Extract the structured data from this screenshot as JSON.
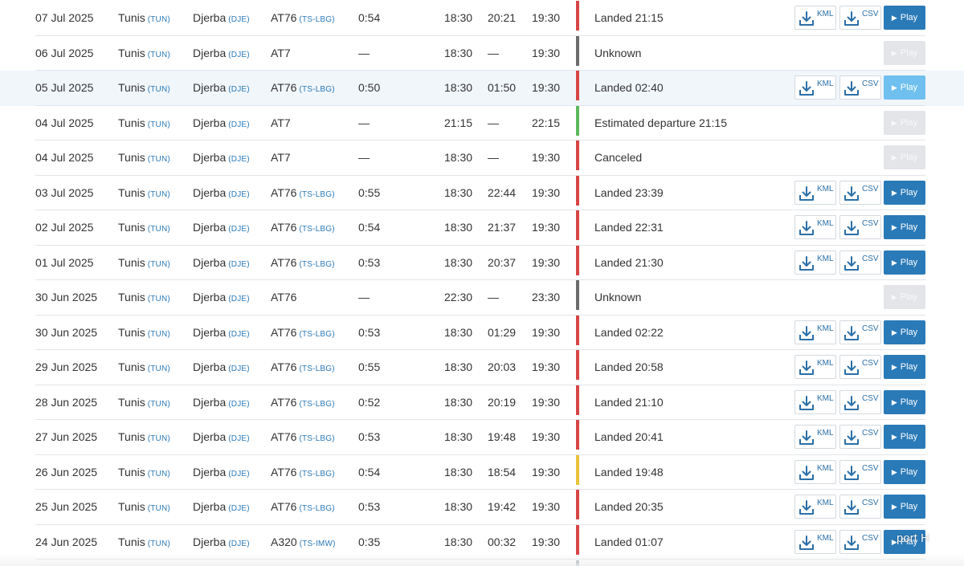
{
  "colors": {
    "red": "#d64545",
    "gray": "#6b6b6b",
    "green": "#5cb85c",
    "yellow": "#e8c33a",
    "play": "#2a7ab8",
    "play_light": "#6fc0ee",
    "play_disabled": "#e3e5e8"
  },
  "labels": {
    "kml": "KML",
    "csv": "CSV",
    "play": "Play"
  },
  "icons": {
    "download": "download-icon",
    "play": "play-triangle-icon"
  },
  "overlay_text": "port   H",
  "flights": [
    {
      "date": "07 Jul 2025",
      "from": "Tunis",
      "from_code": "(TUN)",
      "to": "Djerba",
      "to_code": "(DJE)",
      "aircraft": "AT76",
      "reg": "(TS-LBG)",
      "duration": "0:54",
      "std": "18:30",
      "atd": "20:21",
      "sta": "19:30",
      "status": "Landed 21:15",
      "status_color": "red",
      "has_downloads": true,
      "play_state": "active",
      "highlight": false
    },
    {
      "date": "06 Jul 2025",
      "from": "Tunis",
      "from_code": "(TUN)",
      "to": "Djerba",
      "to_code": "(DJE)",
      "aircraft": "AT7",
      "reg": "",
      "duration": "—",
      "std": "18:30",
      "atd": "—",
      "sta": "19:30",
      "status": "Unknown",
      "status_color": "gray",
      "has_downloads": false,
      "play_state": "disabled",
      "highlight": false
    },
    {
      "date": "05 Jul 2025",
      "from": "Tunis",
      "from_code": "(TUN)",
      "to": "Djerba",
      "to_code": "(DJE)",
      "aircraft": "AT76",
      "reg": "(TS-LBG)",
      "duration": "0:50",
      "std": "18:30",
      "atd": "01:50",
      "sta": "19:30",
      "status": "Landed 02:40",
      "status_color": "red",
      "has_downloads": true,
      "play_state": "light",
      "highlight": true
    },
    {
      "date": "04 Jul 2025",
      "from": "Tunis",
      "from_code": "(TUN)",
      "to": "Djerba",
      "to_code": "(DJE)",
      "aircraft": "AT7",
      "reg": "",
      "duration": "—",
      "std": "21:15",
      "atd": "—",
      "sta": "22:15",
      "status": "Estimated departure 21:15",
      "status_color": "green",
      "has_downloads": false,
      "play_state": "disabled",
      "highlight": false
    },
    {
      "date": "04 Jul 2025",
      "from": "Tunis",
      "from_code": "(TUN)",
      "to": "Djerba",
      "to_code": "(DJE)",
      "aircraft": "AT7",
      "reg": "",
      "duration": "—",
      "std": "18:30",
      "atd": "—",
      "sta": "19:30",
      "status": "Canceled",
      "status_color": "red",
      "has_downloads": false,
      "play_state": "disabled",
      "highlight": false
    },
    {
      "date": "03 Jul 2025",
      "from": "Tunis",
      "from_code": "(TUN)",
      "to": "Djerba",
      "to_code": "(DJE)",
      "aircraft": "AT76",
      "reg": "(TS-LBG)",
      "duration": "0:55",
      "std": "18:30",
      "atd": "22:44",
      "sta": "19:30",
      "status": "Landed 23:39",
      "status_color": "red",
      "has_downloads": true,
      "play_state": "active",
      "highlight": false
    },
    {
      "date": "02 Jul 2025",
      "from": "Tunis",
      "from_code": "(TUN)",
      "to": "Djerba",
      "to_code": "(DJE)",
      "aircraft": "AT76",
      "reg": "(TS-LBG)",
      "duration": "0:54",
      "std": "18:30",
      "atd": "21:37",
      "sta": "19:30",
      "status": "Landed 22:31",
      "status_color": "red",
      "has_downloads": true,
      "play_state": "active",
      "highlight": false
    },
    {
      "date": "01 Jul 2025",
      "from": "Tunis",
      "from_code": "(TUN)",
      "to": "Djerba",
      "to_code": "(DJE)",
      "aircraft": "AT76",
      "reg": "(TS-LBG)",
      "duration": "0:53",
      "std": "18:30",
      "atd": "20:37",
      "sta": "19:30",
      "status": "Landed 21:30",
      "status_color": "red",
      "has_downloads": true,
      "play_state": "active",
      "highlight": false
    },
    {
      "date": "30 Jun 2025",
      "from": "Tunis",
      "from_code": "(TUN)",
      "to": "Djerba",
      "to_code": "(DJE)",
      "aircraft": "AT76",
      "reg": "",
      "duration": "—",
      "std": "22:30",
      "atd": "—",
      "sta": "23:30",
      "status": "Unknown",
      "status_color": "gray",
      "has_downloads": false,
      "play_state": "disabled",
      "highlight": false
    },
    {
      "date": "30 Jun 2025",
      "from": "Tunis",
      "from_code": "(TUN)",
      "to": "Djerba",
      "to_code": "(DJE)",
      "aircraft": "AT76",
      "reg": "(TS-LBG)",
      "duration": "0:53",
      "std": "18:30",
      "atd": "01:29",
      "sta": "19:30",
      "status": "Landed 02:22",
      "status_color": "red",
      "has_downloads": true,
      "play_state": "active",
      "highlight": false
    },
    {
      "date": "29 Jun 2025",
      "from": "Tunis",
      "from_code": "(TUN)",
      "to": "Djerba",
      "to_code": "(DJE)",
      "aircraft": "AT76",
      "reg": "(TS-LBG)",
      "duration": "0:55",
      "std": "18:30",
      "atd": "20:03",
      "sta": "19:30",
      "status": "Landed 20:58",
      "status_color": "red",
      "has_downloads": true,
      "play_state": "active",
      "highlight": false
    },
    {
      "date": "28 Jun 2025",
      "from": "Tunis",
      "from_code": "(TUN)",
      "to": "Djerba",
      "to_code": "(DJE)",
      "aircraft": "AT76",
      "reg": "(TS-LBG)",
      "duration": "0:52",
      "std": "18:30",
      "atd": "20:19",
      "sta": "19:30",
      "status": "Landed 21:10",
      "status_color": "red",
      "has_downloads": true,
      "play_state": "active",
      "highlight": false
    },
    {
      "date": "27 Jun 2025",
      "from": "Tunis",
      "from_code": "(TUN)",
      "to": "Djerba",
      "to_code": "(DJE)",
      "aircraft": "AT76",
      "reg": "(TS-LBG)",
      "duration": "0:53",
      "std": "18:30",
      "atd": "19:48",
      "sta": "19:30",
      "status": "Landed 20:41",
      "status_color": "red",
      "has_downloads": true,
      "play_state": "active",
      "highlight": false
    },
    {
      "date": "26 Jun 2025",
      "from": "Tunis",
      "from_code": "(TUN)",
      "to": "Djerba",
      "to_code": "(DJE)",
      "aircraft": "AT76",
      "reg": "(TS-LBG)",
      "duration": "0:54",
      "std": "18:30",
      "atd": "18:54",
      "sta": "19:30",
      "status": "Landed 19:48",
      "status_color": "yellow",
      "has_downloads": true,
      "play_state": "active",
      "highlight": false
    },
    {
      "date": "25 Jun 2025",
      "from": "Tunis",
      "from_code": "(TUN)",
      "to": "Djerba",
      "to_code": "(DJE)",
      "aircraft": "AT76",
      "reg": "(TS-LBG)",
      "duration": "0:53",
      "std": "18:30",
      "atd": "19:42",
      "sta": "19:30",
      "status": "Landed 20:35",
      "status_color": "red",
      "has_downloads": true,
      "play_state": "active",
      "highlight": false
    },
    {
      "date": "24 Jun 2025",
      "from": "Tunis",
      "from_code": "(TUN)",
      "to": "Djerba",
      "to_code": "(DJE)",
      "aircraft": "A320",
      "reg": "(TS-IMW)",
      "duration": "0:35",
      "std": "18:30",
      "atd": "00:32",
      "sta": "19:30",
      "status": "Landed 01:07",
      "status_color": "red",
      "has_downloads": true,
      "play_state": "active",
      "highlight": false
    }
  ]
}
